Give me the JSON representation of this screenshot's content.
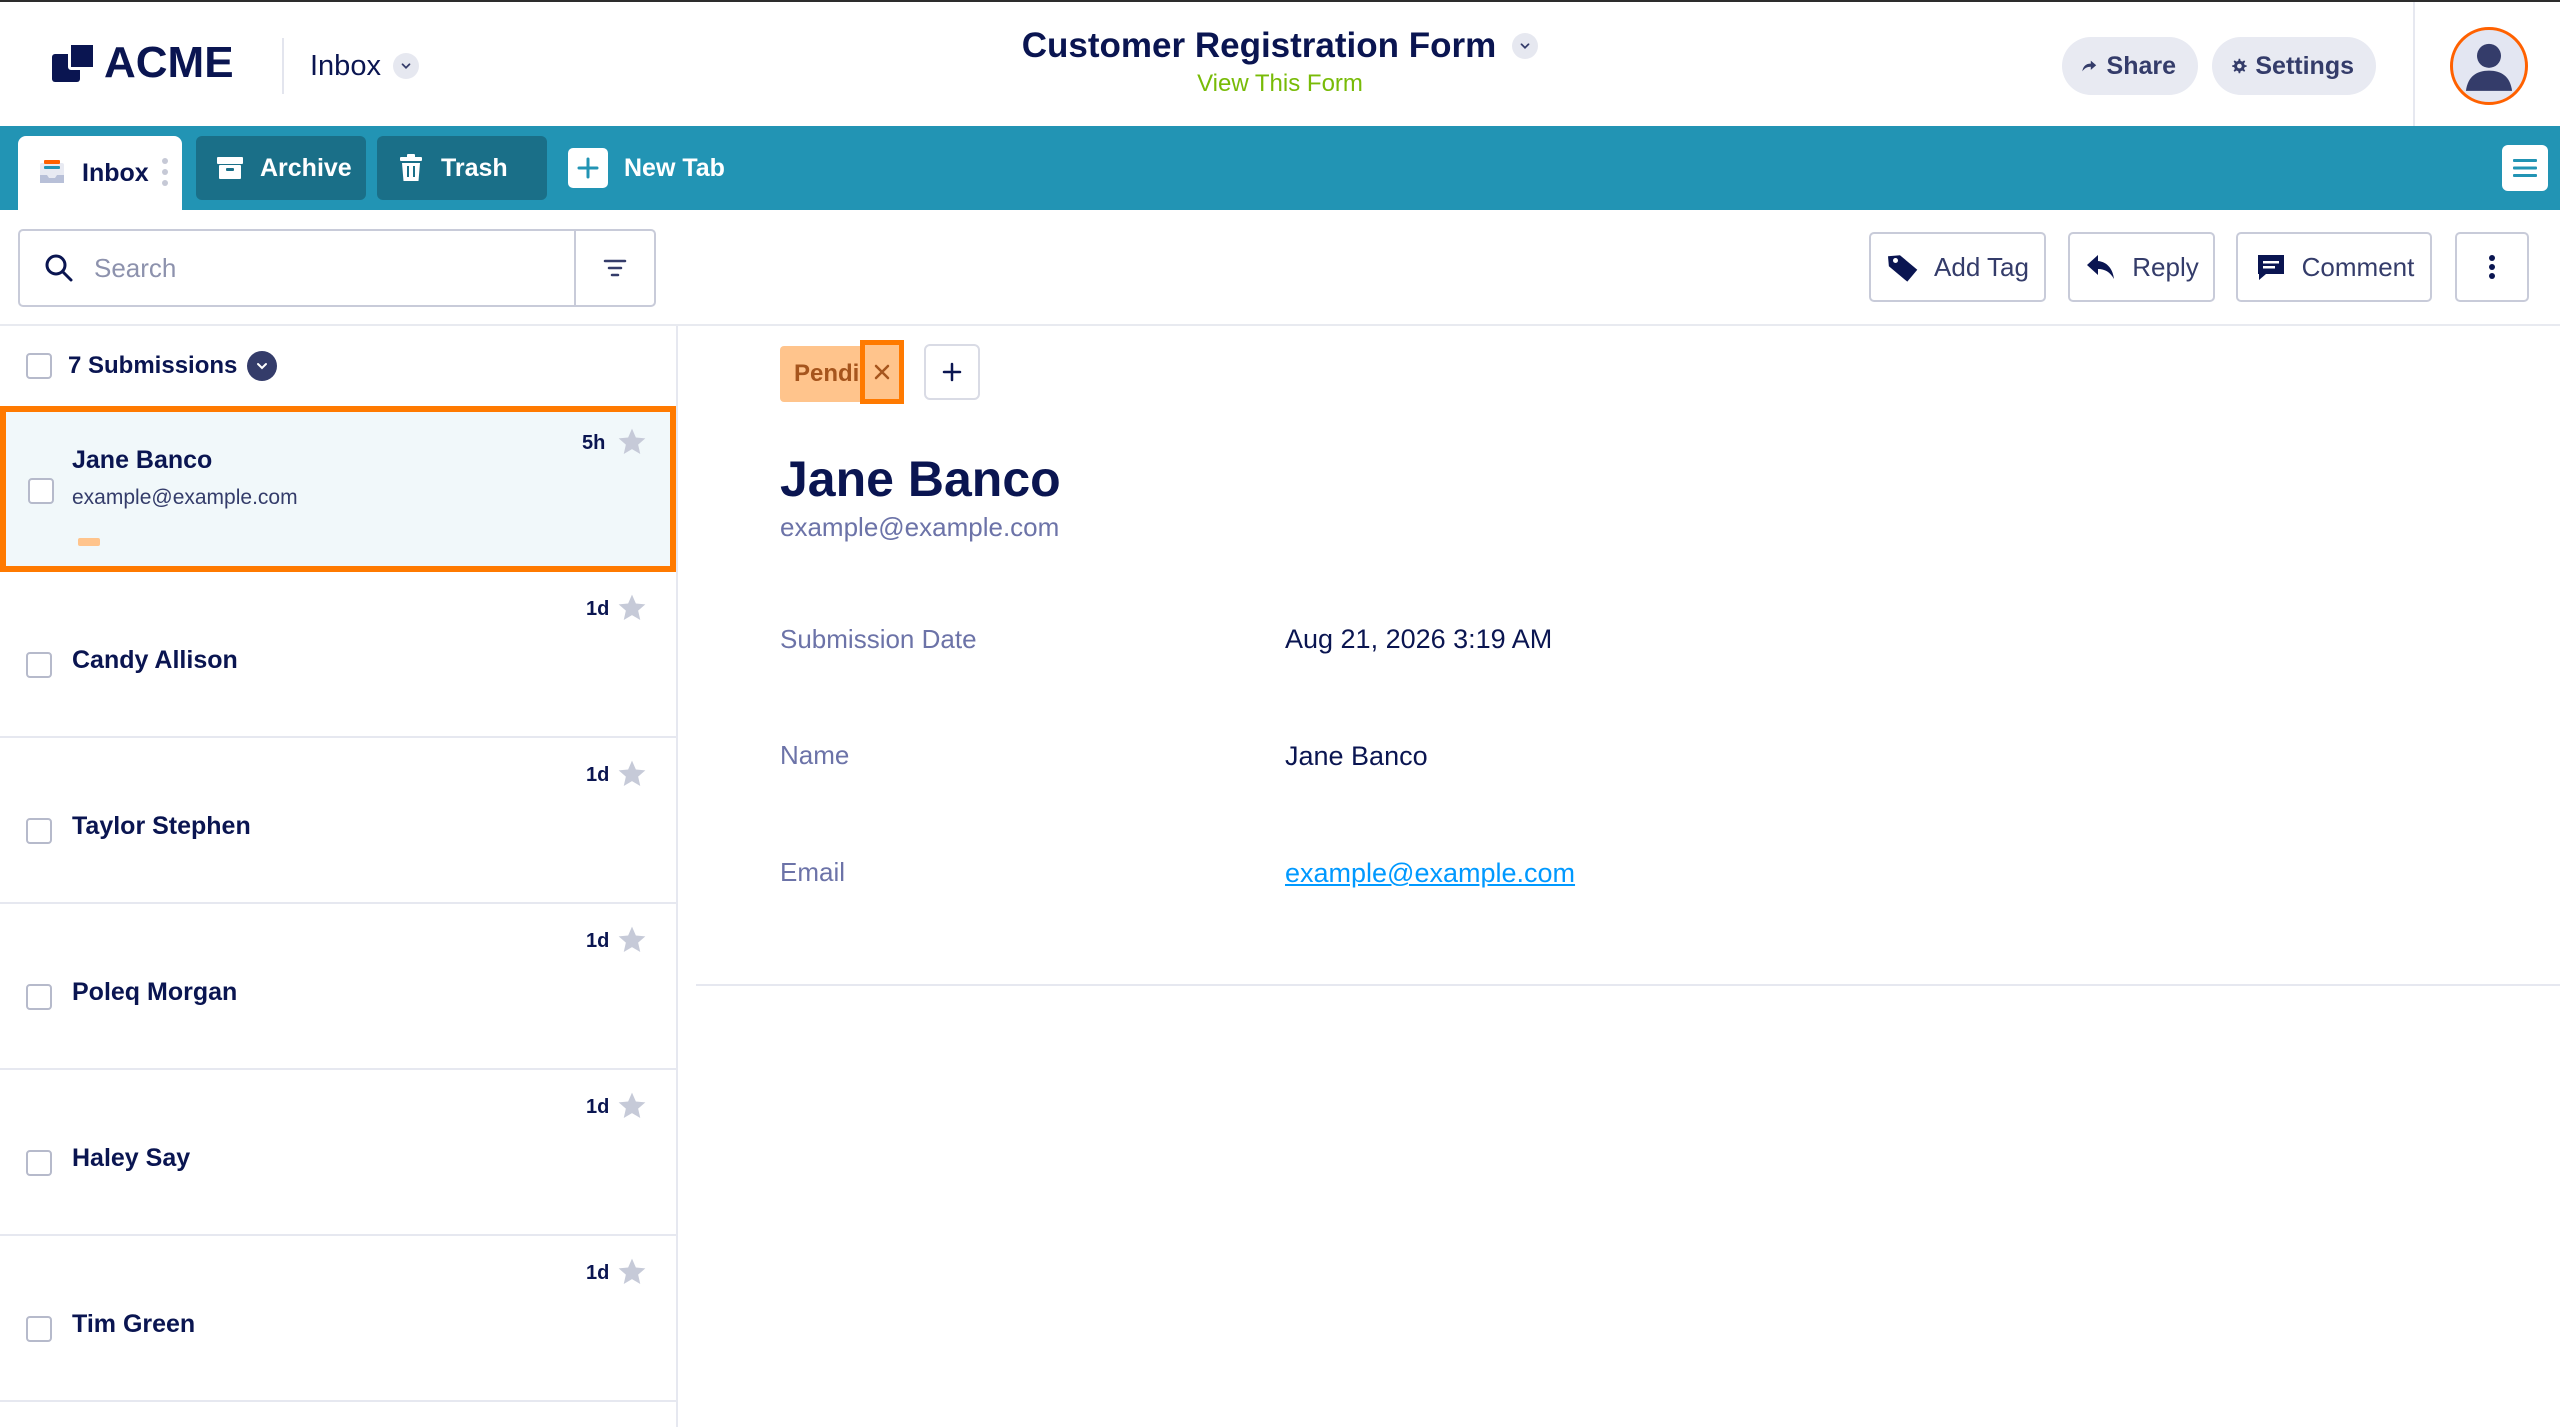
{
  "header": {
    "logo_text": "ACME",
    "inbox_label": "Inbox",
    "form_title": "Customer Registration Form",
    "view_form": "View This Form",
    "share_label": "Share",
    "settings_label": "Settings"
  },
  "tabs": {
    "inbox": "Inbox",
    "archive": "Archive",
    "trash": "Trash",
    "new_tab": "New Tab"
  },
  "toolbar": {
    "search_placeholder": "Search",
    "add_tag": "Add Tag",
    "reply": "Reply",
    "comment": "Comment"
  },
  "list": {
    "count_label": "7 Submissions",
    "rows": [
      {
        "name": "Jane Banco",
        "email": "example@example.com",
        "time": "5h"
      },
      {
        "name": "Candy Allison",
        "time": "1d"
      },
      {
        "name": "Taylor Stephen",
        "time": "1d"
      },
      {
        "name": "Poleq Morgan",
        "time": "1d"
      },
      {
        "name": "Haley Say",
        "time": "1d"
      },
      {
        "name": "Tim Green",
        "time": "1d"
      }
    ]
  },
  "detail": {
    "tag_label": "Pendi",
    "name": "Jane Banco",
    "email": "example@example.com",
    "fields": [
      {
        "label": "Submission Date",
        "value": "Aug 21, 2026 3:19 AM"
      },
      {
        "label": "Name",
        "value": "Jane Banco"
      },
      {
        "label": "Email",
        "value": "example@example.com"
      }
    ]
  },
  "colors": {
    "tabbar": "#2294b4",
    "tab_dark": "#1a6f88",
    "navy": "#0a1551",
    "accent_orange": "#ff7a00",
    "tag_peach": "#ffc48c",
    "link_blue": "#0099ff",
    "view_form_green": "#78bb07"
  }
}
